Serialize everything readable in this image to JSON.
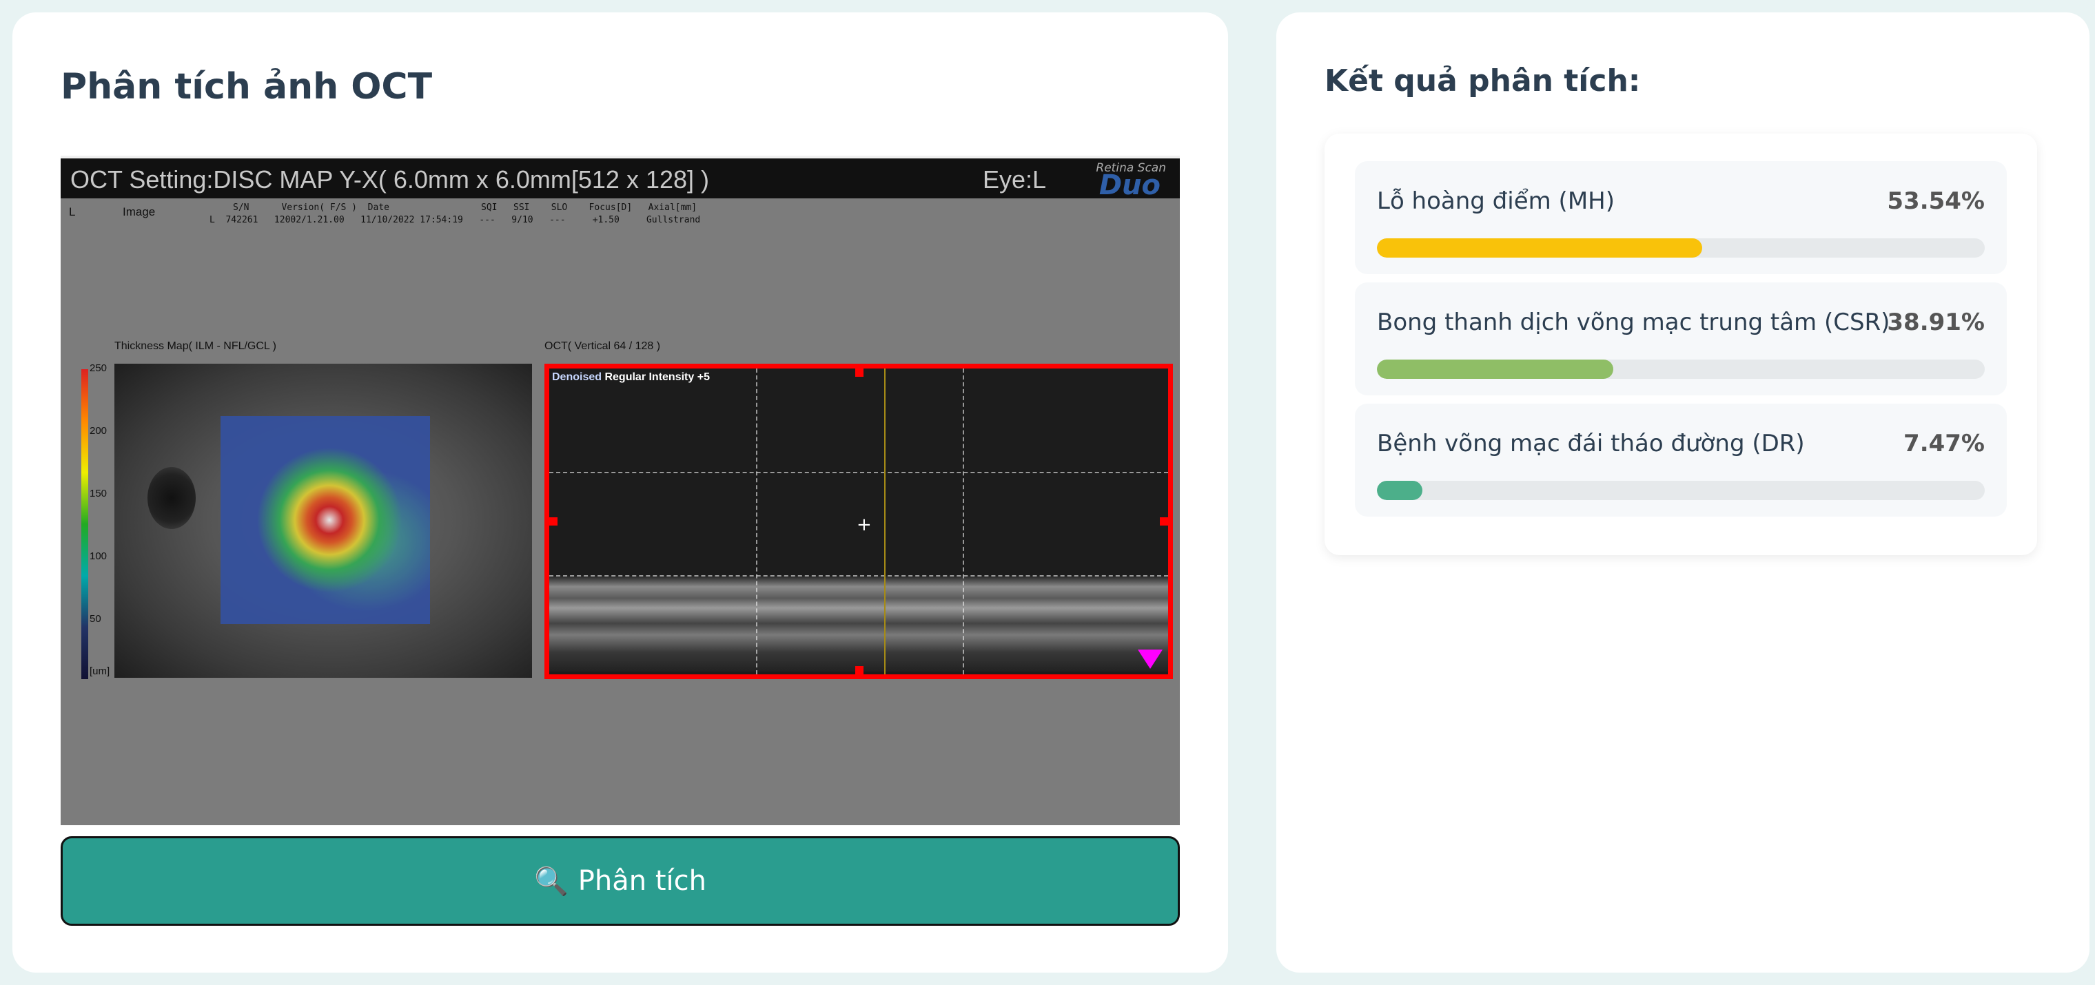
{
  "left": {
    "title": "Phân tích ảnh OCT",
    "oct_image": {
      "setting": "OCT Setting:DISC MAP Y-X( 6.0mm x 6.0mm[512 x 128] )",
      "eye": "Eye:L",
      "brand_small": "Retina Scan",
      "brand_big": "Duo",
      "meta_l": "L",
      "meta_image": "Image",
      "meta_header": "S/N      Version( F/S )  Date                 SQI   SSI    SLO    Focus[D]   Axial[mm]",
      "meta_values": "L  742261   12002/1.21.00   11/10/2022 17:54:19   ---   9/10   ---     +1.50     Gullstrand",
      "thickness_label": "Thickness Map( ILM - NFL/GCL )",
      "oct_label": "OCT( Vertical  64 / 128 )",
      "scale_labels": [
        "250",
        "200",
        "150",
        "100",
        "50",
        "[um]"
      ],
      "scan_label_denoised": "Denoised",
      "scan_label_rest": "Regular  Intensity +5"
    },
    "button_icon": "🔍",
    "button_label": "Phân tích"
  },
  "right": {
    "title": "Kết quả phân tích:",
    "results": [
      {
        "name": "Lỗ hoàng điểm (MH)",
        "percent": "53.54%",
        "value": 53.54,
        "color": "#f9c20a"
      },
      {
        "name": "Bong thanh dịch võng mạc trung tâm (CSR)",
        "percent": "38.91%",
        "value": 38.91,
        "color": "#8fbe66"
      },
      {
        "name": "Bệnh võng mạc đái tháo đường (DR)",
        "percent": "7.47%",
        "value": 7.47,
        "color": "#4caf8a"
      }
    ]
  }
}
